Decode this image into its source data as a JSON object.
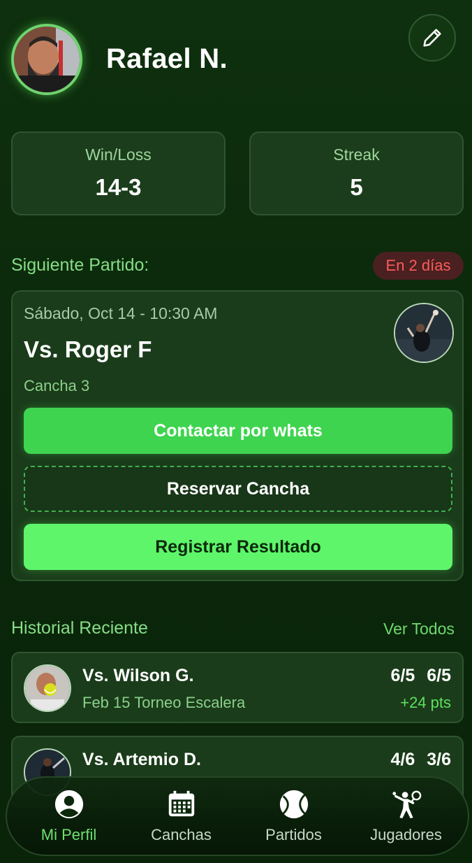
{
  "profile": {
    "name": "Rafael N."
  },
  "stats": [
    {
      "label": "Win/Loss",
      "value": "14-3"
    },
    {
      "label": "Streak",
      "value": "5"
    }
  ],
  "next_match": {
    "section_title": "Siguiente Partido:",
    "badge": "En 2 días",
    "date": "Sábado, Oct 14 - 10:30 AM",
    "opponent": "Vs. Roger F",
    "court": "Cancha 3",
    "contact_label": "Contactar por whats",
    "reserve_label": "Reservar Cancha",
    "register_label": "Registrar Resultado"
  },
  "history": {
    "section_title": "Historial Reciente",
    "see_all": "Ver Todos",
    "items": [
      {
        "opponent": "Vs. Wilson G.",
        "event": "Feb 15 Torneo Escalera",
        "score": "6/5 6/5",
        "points": "+24 pts"
      },
      {
        "opponent": "Vs. Artemio D.",
        "event": "",
        "score": "4/6 3/6",
        "points": ""
      }
    ]
  },
  "nav": [
    {
      "label": "Mi Perfil",
      "icon": "user-circle-icon",
      "active": true
    },
    {
      "label": "Canchas",
      "icon": "calendar-icon",
      "active": false
    },
    {
      "label": "Partidos",
      "icon": "tennis-ball-icon",
      "active": false
    },
    {
      "label": "Jugadores",
      "icon": "tennis-player-icon",
      "active": false
    }
  ],
  "colors": {
    "accent": "#3fd44f",
    "accent_bright": "#5ef56a",
    "badge_text": "#ff5a5a",
    "background": "#0c2a0c"
  }
}
